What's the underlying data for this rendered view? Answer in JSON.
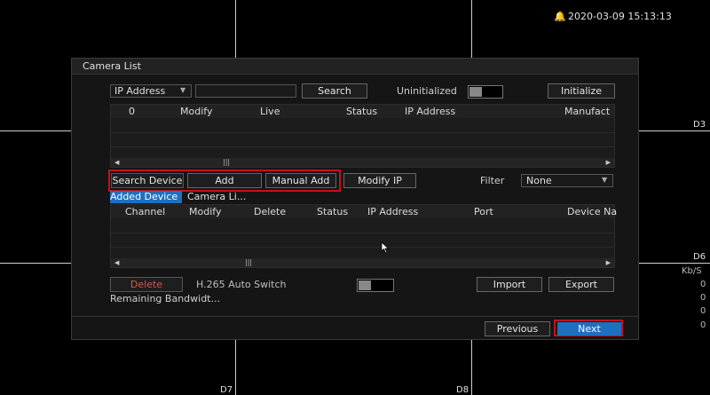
{
  "topbar": {
    "datetime": "2020-03-09 15:13:13",
    "alarm_icon": "bell-icon"
  },
  "channels": {
    "d3": "D3",
    "d6": "D6",
    "d7": "D7",
    "d8": "D8"
  },
  "side_panel": {
    "rate_label": "Kb/S",
    "values": [
      "0",
      "0",
      "0",
      "0"
    ]
  },
  "dialog": {
    "title": "Camera List",
    "search_bar": {
      "filter_select": "IP Address",
      "search_input": "",
      "search_button": "Search",
      "uninitialized_label": "Uninitialized",
      "initialize_button": "Initialize"
    },
    "device_table": {
      "columns": [
        "0",
        "Modify",
        "Live",
        "Status",
        "IP Address",
        "Manufact"
      ]
    },
    "actions": {
      "search_device": "Search Device",
      "add": "Add",
      "manual_add": "Manual Add",
      "modify_ip": "Modify IP",
      "filter_label": "Filter",
      "filter_value": "None"
    },
    "tabs": [
      "Added Device",
      "Camera Li..."
    ],
    "added_table": {
      "columns": [
        "Channel",
        "Modify",
        "Delete",
        "Status",
        "IP Address",
        "Port",
        "Device Na"
      ]
    },
    "bottom": {
      "delete": "Delete",
      "h265_label": "H.265 Auto Switch",
      "import": "Import",
      "export": "Export",
      "remaining": "Remaining Bandwidt..."
    },
    "footer": {
      "previous": "Previous",
      "next": "Next"
    }
  }
}
